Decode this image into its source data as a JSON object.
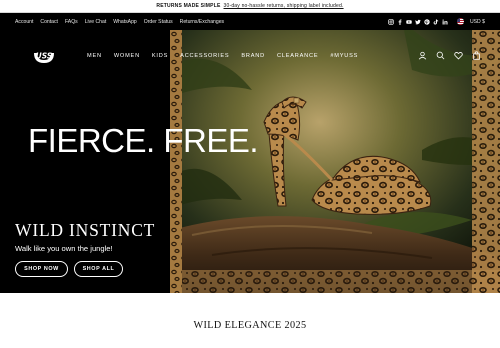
{
  "announcement": {
    "strong": "RETURNS MADE SIMPLE",
    "link": "30-day no-hassle returns, shipping label included."
  },
  "utility_links": [
    "Account",
    "Contact",
    "FAQs",
    "Live Chat",
    "WhatsApp",
    "Order Status",
    "Returns/Exchanges"
  ],
  "social_icons": [
    "instagram-icon",
    "facebook-icon",
    "youtube-icon",
    "twitter-icon",
    "pinterest-icon",
    "tiktok-icon",
    "linkedin-icon"
  ],
  "currency": "USD $",
  "brand": {
    "logo": "USS"
  },
  "nav": [
    "MEN",
    "WOMEN",
    "KIDS",
    "ACCESSORIES",
    "BRAND",
    "CLEARANCE",
    "#MYUSS"
  ],
  "header_icons": [
    "account-icon",
    "search-icon",
    "wishlist-icon",
    "cart-icon"
  ],
  "hero": {
    "headline": "FIERCE. FREE.",
    "subhead": "WILD INSTINCT",
    "tagline": "Walk like you own the jungle!",
    "buttons": {
      "shop_now": "SHOP NOW",
      "shop_all": "SHOP ALL"
    }
  },
  "section": {
    "title": "WILD ELEGANCE 2025"
  },
  "colors": {
    "background": "#000000",
    "text": "#ffffff",
    "page": "#ffffff",
    "leopard_base": "#b98a4c",
    "leopard_spot": "#2a1a0a",
    "jungle": "#3a4a1c"
  }
}
